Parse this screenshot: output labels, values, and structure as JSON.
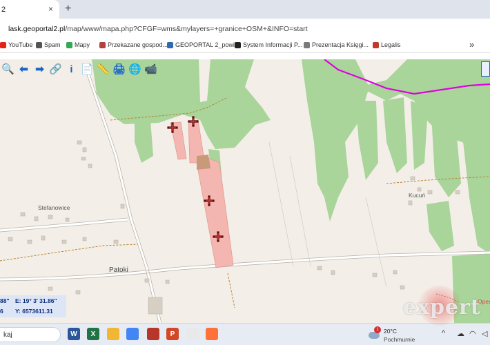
{
  "browser": {
    "tab": {
      "title": "2",
      "close_icon": "×"
    },
    "new_tab_icon": "+",
    "url_host": "lask.geoportal2.pl",
    "url_path": "/map/www/mapa.php?CFGF=wms&mylayers=+granice+OSM+&INFO=start",
    "bookmarks": [
      {
        "label": "YouTube",
        "icon": "youtube-icon",
        "color": "#e62117"
      },
      {
        "label": "Spam",
        "icon": "spam-icon",
        "color": "#555555"
      },
      {
        "label": "Mapy",
        "icon": "maps-pin-icon",
        "color": "#34a853"
      },
      {
        "label": "Przekazane gospod...",
        "icon": "document-icon",
        "color": "#b0413e"
      },
      {
        "label": "GEOPORTAL 2_powi...",
        "icon": "geoportal-icon",
        "color": "#2b6cb0"
      },
      {
        "label": "System Informacji P...",
        "icon": "power-icon",
        "color": "#222222"
      },
      {
        "label": "Prezentacja Księgi...",
        "icon": "presentation-icon",
        "color": "#7a7a7a"
      },
      {
        "label": "Legalis",
        "icon": "legalis-icon",
        "color": "#c0392b"
      }
    ],
    "bookmarks_more": "»"
  },
  "map": {
    "labels": {
      "stefanowice": "Stefanowice",
      "patoki": "Patoki",
      "kucun": "Kucuń",
      "opes": "Opes"
    },
    "coords": {
      "lat_label": "88\"",
      "east": "E: 19° 3' 31.86\"",
      "x_label": "6",
      "y": "Y: 6573611.31"
    },
    "colors": {
      "forest": "#a9d49a",
      "background": "#f3efe8",
      "parcel": "#f4b6b0",
      "boundary": "#e000e0",
      "marker": "#7b1010"
    },
    "toolbar": [
      {
        "name": "zoom-search-icon",
        "glyph": "🔍"
      },
      {
        "name": "arrow-left-icon",
        "glyph": "⬅"
      },
      {
        "name": "arrow-right-icon",
        "glyph": "➡"
      },
      {
        "name": "link-icon",
        "glyph": "🔗"
      },
      {
        "name": "info-icon",
        "glyph": "i"
      },
      {
        "name": "document-search-icon",
        "glyph": "📄"
      },
      {
        "name": "measure-icon",
        "glyph": "📏"
      },
      {
        "name": "print-icon",
        "glyph": "🖨"
      },
      {
        "name": "globe-icon",
        "glyph": "🌐"
      },
      {
        "name": "camera-icon",
        "glyph": "📹"
      }
    ]
  },
  "taskbar": {
    "search_text": "kaj",
    "apps": [
      {
        "name": "word-app-icon",
        "label": "W",
        "color": "#2b579a"
      },
      {
        "name": "excel-app-icon",
        "label": "X",
        "color": "#217346"
      },
      {
        "name": "file-explorer-icon",
        "label": "",
        "color": "#f2b632"
      },
      {
        "name": "chrome-app-icon",
        "label": "",
        "color": "#4285f4"
      },
      {
        "name": "pdf-app-icon",
        "label": "",
        "color": "#b8352a"
      },
      {
        "name": "powerpoint-app-icon",
        "label": "P",
        "color": "#d24726"
      },
      {
        "name": "app-icon-generic",
        "label": "",
        "color": "#e9e9e9"
      },
      {
        "name": "firefox-app-icon",
        "label": "",
        "color": "#ff7139"
      }
    ],
    "weather": {
      "temp": "20°C",
      "condition": "Pochmurnie",
      "badge": "1"
    },
    "tray": {
      "chevron": "^",
      "network_icon": "wifi-icon"
    }
  },
  "watermark": "expert"
}
